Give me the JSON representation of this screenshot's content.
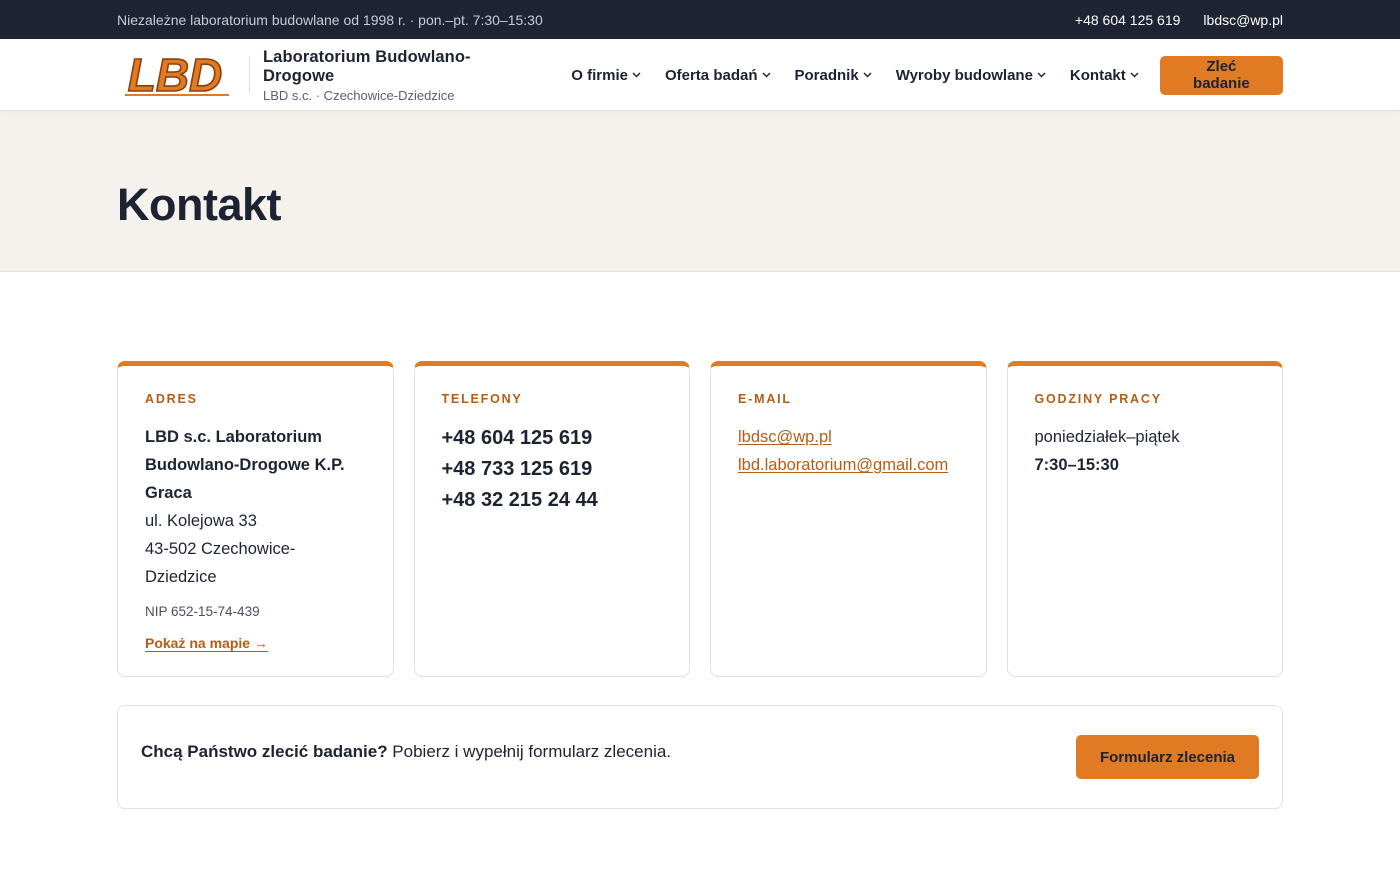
{
  "topbar": {
    "tagline": "Niezależne laboratorium budowlane od 1998 r. · pon.–pt. 7:30–15:30",
    "phone": "+48 604 125 619",
    "email": "lbdsc@wp.pl"
  },
  "header": {
    "logo_text": "LBD",
    "brand_title": "Laboratorium Budowlano-Drogowe",
    "brand_sub": "LBD s.c. · Czechowice-Dziedzice",
    "nav": [
      {
        "label": "O firmie",
        "icon": "chevron-down-icon"
      },
      {
        "label": "Oferta badań",
        "icon": "chevron-down-icon"
      },
      {
        "label": "Poradnik",
        "icon": "chevron-down-icon"
      },
      {
        "label": "Wyroby budowlane",
        "icon": "chevron-down-icon"
      },
      {
        "label": "Kontakt",
        "icon": "chevron-down-icon"
      }
    ],
    "cta_label": "Zleć badanie"
  },
  "hero": {
    "title": "Kontakt"
  },
  "cards": {
    "address": {
      "label": "ADRES",
      "name": "LBD s.c. Laboratorium Budowlano-Drogowe K.P. Graca",
      "street": "ul. Kolejowa 33",
      "city": "43-502 Czechowice-Dziedzice",
      "nip": "NIP 652-15-74-439",
      "map_link": "Pokaż na mapie →"
    },
    "phones": {
      "label": "TELEFONY",
      "items": [
        "+48 604 125 619",
        "+48 733 125 619",
        "+48 32 215 24 44"
      ]
    },
    "email": {
      "label": "E-MAIL",
      "items": [
        "lbdsc@wp.pl",
        "lbd.laboratorium@gmail.com"
      ]
    },
    "hours": {
      "label": "GODZINY PRACY",
      "days": "poniedziałek–piątek",
      "time": "7:30–15:30"
    }
  },
  "cta": {
    "question": "Chcą Państwo zlecić badanie?",
    "text": " Pobierz i wypełnij formularz zlecenia.",
    "button": "Formularz zlecenia"
  },
  "colors": {
    "accent": "#e07b24",
    "accent_text": "#b55d16",
    "dark": "#1e2433",
    "hero_bg": "#f5f2ed"
  }
}
